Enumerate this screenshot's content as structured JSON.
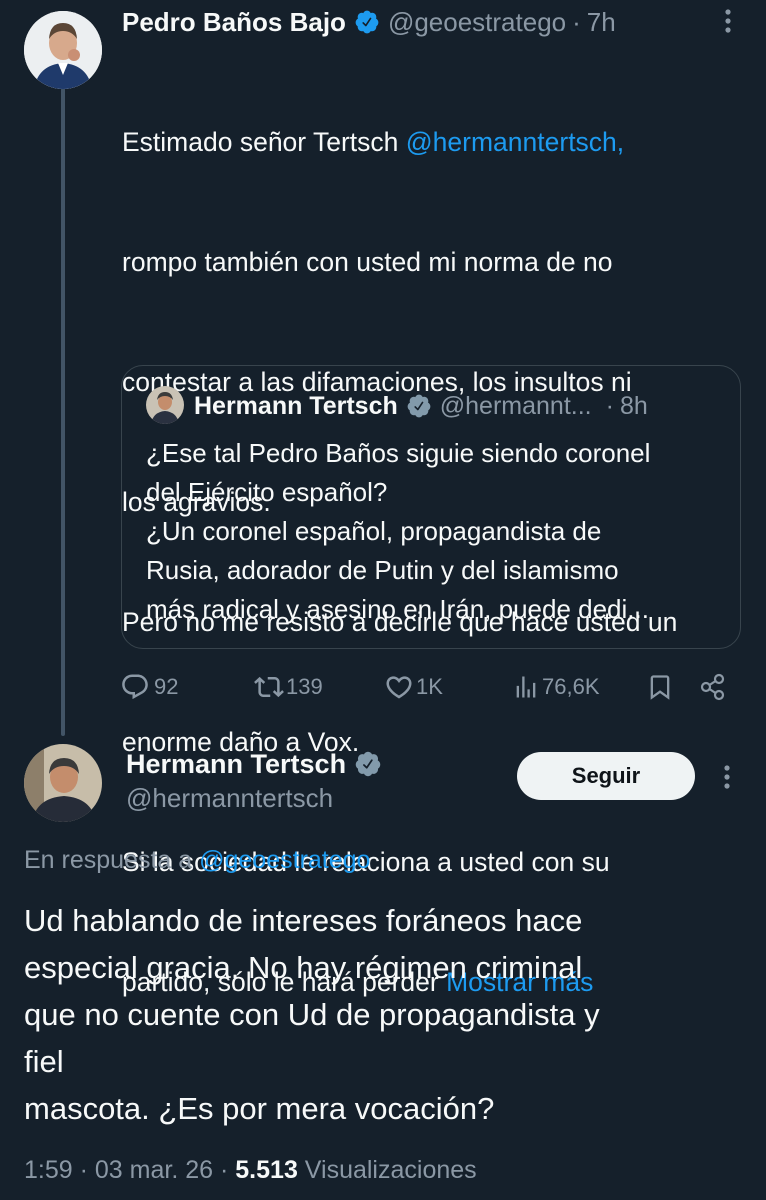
{
  "parent_tweet": {
    "author_name": "Pedro Baños Bajo",
    "handle": "@geoestratego",
    "separator": "·",
    "time": "7h",
    "text_lines": [
      "Estimado señor Tertsch ",
      "rompo también con usted mi norma de no",
      "contestar a las difamaciones, los insultos ni",
      "los agravios.",
      "Pero no me resisto a decirle que hace usted un",
      "enorme daño a Vox.",
      "Si la sociedad le relaciona a usted con su",
      "partido, sólo le hará perder "
    ],
    "mention": "@hermanntertsch,",
    "show_more": "Mostrar más",
    "quote": {
      "author_name": "Hermann Tertsch",
      "handle": "@hermannt...",
      "separator": "·",
      "time": "8h",
      "text_lines": [
        "¿Ese tal Pedro Baños siguie siendo coronel",
        "del Ejército español?",
        "¿Un coronel español, propagandista de",
        "Rusia, adorador de Putin y del islamismo",
        "más radical y asesino en Irán, puede dedi..."
      ]
    },
    "actions": {
      "replies": "92",
      "reposts": "139",
      "likes": "1K",
      "views": "76,6K"
    }
  },
  "main_tweet": {
    "author_name": "Hermann Tertsch",
    "handle": "@hermanntertsch",
    "follow_label": "Seguir",
    "reply_prefix": "En respuesta a ",
    "reply_to": "@geoestratego",
    "text_lines": [
      "Ud hablando de intereses foráneos hace",
      "especial gracia. No hay régimen criminal",
      "que no cuente con Ud de propagandista y",
      "fiel",
      "mascota. ¿Es por mera vocación?"
    ],
    "time": "1:59",
    "sep1": "·",
    "date": "03 mar. 26",
    "sep2": "·",
    "views_count": "5.513",
    "views_label": "Visualizaciones"
  },
  "colors": {
    "background": "#15202b",
    "text": "#f7f9f9",
    "muted": "#8b98a5",
    "link": "#1d9bf0",
    "verified_badge": "#1d9bf0",
    "verified_badge_gray": "#829aab",
    "border": "#38444d"
  },
  "icons": [
    "verified-icon",
    "more-icon",
    "reply-icon",
    "repost-icon",
    "like-icon",
    "views-icon",
    "bookmark-icon",
    "share-icon"
  ]
}
